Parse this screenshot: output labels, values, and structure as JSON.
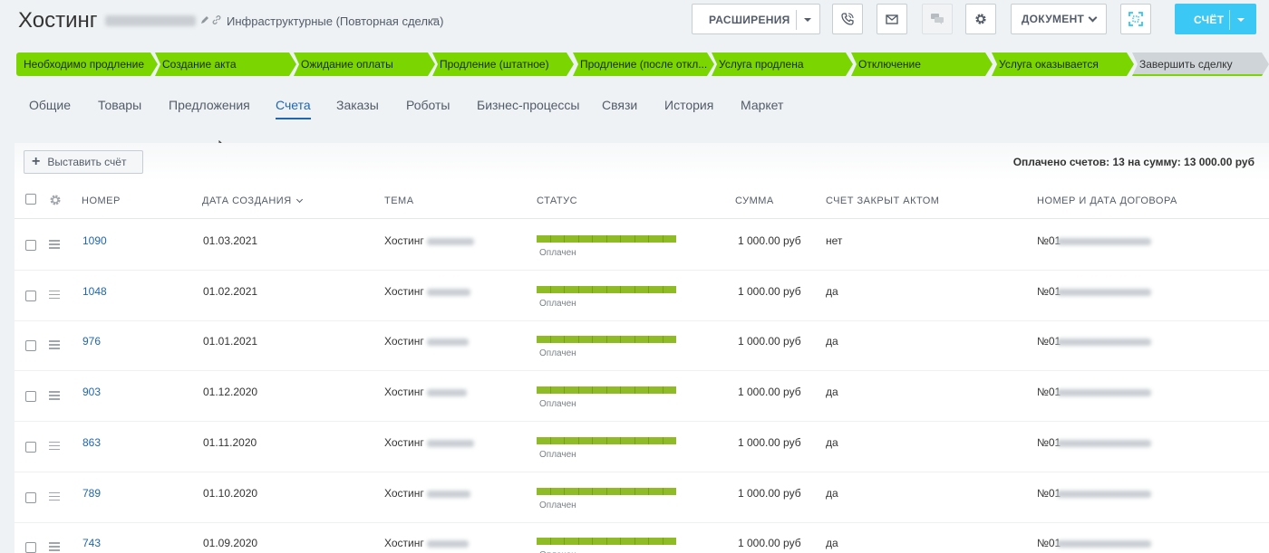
{
  "header": {
    "title": "Хостинг",
    "category": "Инфраструктурные (Повторная сделка)",
    "buttons": {
      "extensions": "РАСШИРЕНИЯ",
      "document": "ДОКУМЕНТ",
      "invoice": "СЧЁТ"
    },
    "icons": [
      "pencil-icon",
      "link-icon",
      "phone-icon",
      "mail-icon",
      "chat-icon",
      "gear-icon",
      "expand-icon"
    ]
  },
  "stages": [
    {
      "label": "Необходимо продление"
    },
    {
      "label": "Создание акта"
    },
    {
      "label": "Ожидание оплаты"
    },
    {
      "label": "Продление (штатное)"
    },
    {
      "label": "Продление (после откл..."
    },
    {
      "label": "Услуга продлена"
    },
    {
      "label": "Отключение"
    },
    {
      "label": "Услуга оказывается"
    },
    {
      "label": "Завершить сделку"
    }
  ],
  "tabs": [
    {
      "label": "Общие"
    },
    {
      "label": "Товары"
    },
    {
      "label": "Предложения"
    },
    {
      "label": "Счета",
      "active": true
    },
    {
      "label": "Заказы"
    },
    {
      "label": "Роботы"
    },
    {
      "label": "Бизнес-процессы"
    },
    {
      "label": "Связи"
    },
    {
      "label": "История"
    },
    {
      "label": "Маркет"
    }
  ],
  "toolbar": {
    "add_label": "Выставить счёт",
    "summary": "Оплачено счетов: 13 на сумму: 13 000.00 руб"
  },
  "table": {
    "columns": [
      "НОМЕР",
      "ДАТА СОЗДАНИЯ",
      "ТЕМА",
      "СТАТУС",
      "СУММА",
      "СЧЕТ ЗАКРЫТ АКТОМ",
      "НОМЕР И ДАТА ДОГОВОРА"
    ],
    "rows": [
      {
        "number": "1090",
        "date": "01.03.2021",
        "topic": "Хостинг",
        "status": "Оплачен",
        "sum": "1 000.00 руб",
        "closed": "нет",
        "contract": "№01"
      },
      {
        "number": "1048",
        "date": "01.02.2021",
        "topic": "Хостинг",
        "status": "Оплачен",
        "sum": "1 000.00 руб",
        "closed": "да",
        "contract": "№01"
      },
      {
        "number": "976",
        "date": "01.01.2021",
        "topic": "Хостинг",
        "status": "Оплачен",
        "sum": "1 000.00 руб",
        "closed": "да",
        "contract": "№01"
      },
      {
        "number": "903",
        "date": "01.12.2020",
        "topic": "Хостинг",
        "status": "Оплачен",
        "sum": "1 000.00 руб",
        "closed": "да",
        "contract": "№01"
      },
      {
        "number": "863",
        "date": "01.11.2020",
        "topic": "Хостинг",
        "status": "Оплачен",
        "sum": "1 000.00 руб",
        "closed": "да",
        "contract": "№01"
      },
      {
        "number": "789",
        "date": "01.10.2020",
        "topic": "Хостинг",
        "status": "Оплачен",
        "sum": "1 000.00 руб",
        "closed": "да",
        "contract": "№01"
      },
      {
        "number": "743",
        "date": "01.09.2020",
        "topic": "Хостинг",
        "status": "Оплачен",
        "sum": "1 000.00 руб",
        "closed": "да",
        "contract": "№01"
      }
    ]
  },
  "colors": {
    "stage_green": "#7bd500",
    "link_blue": "#2067b0",
    "status_green": "#8fbc26",
    "invoice_button": "#3bc8f5"
  }
}
